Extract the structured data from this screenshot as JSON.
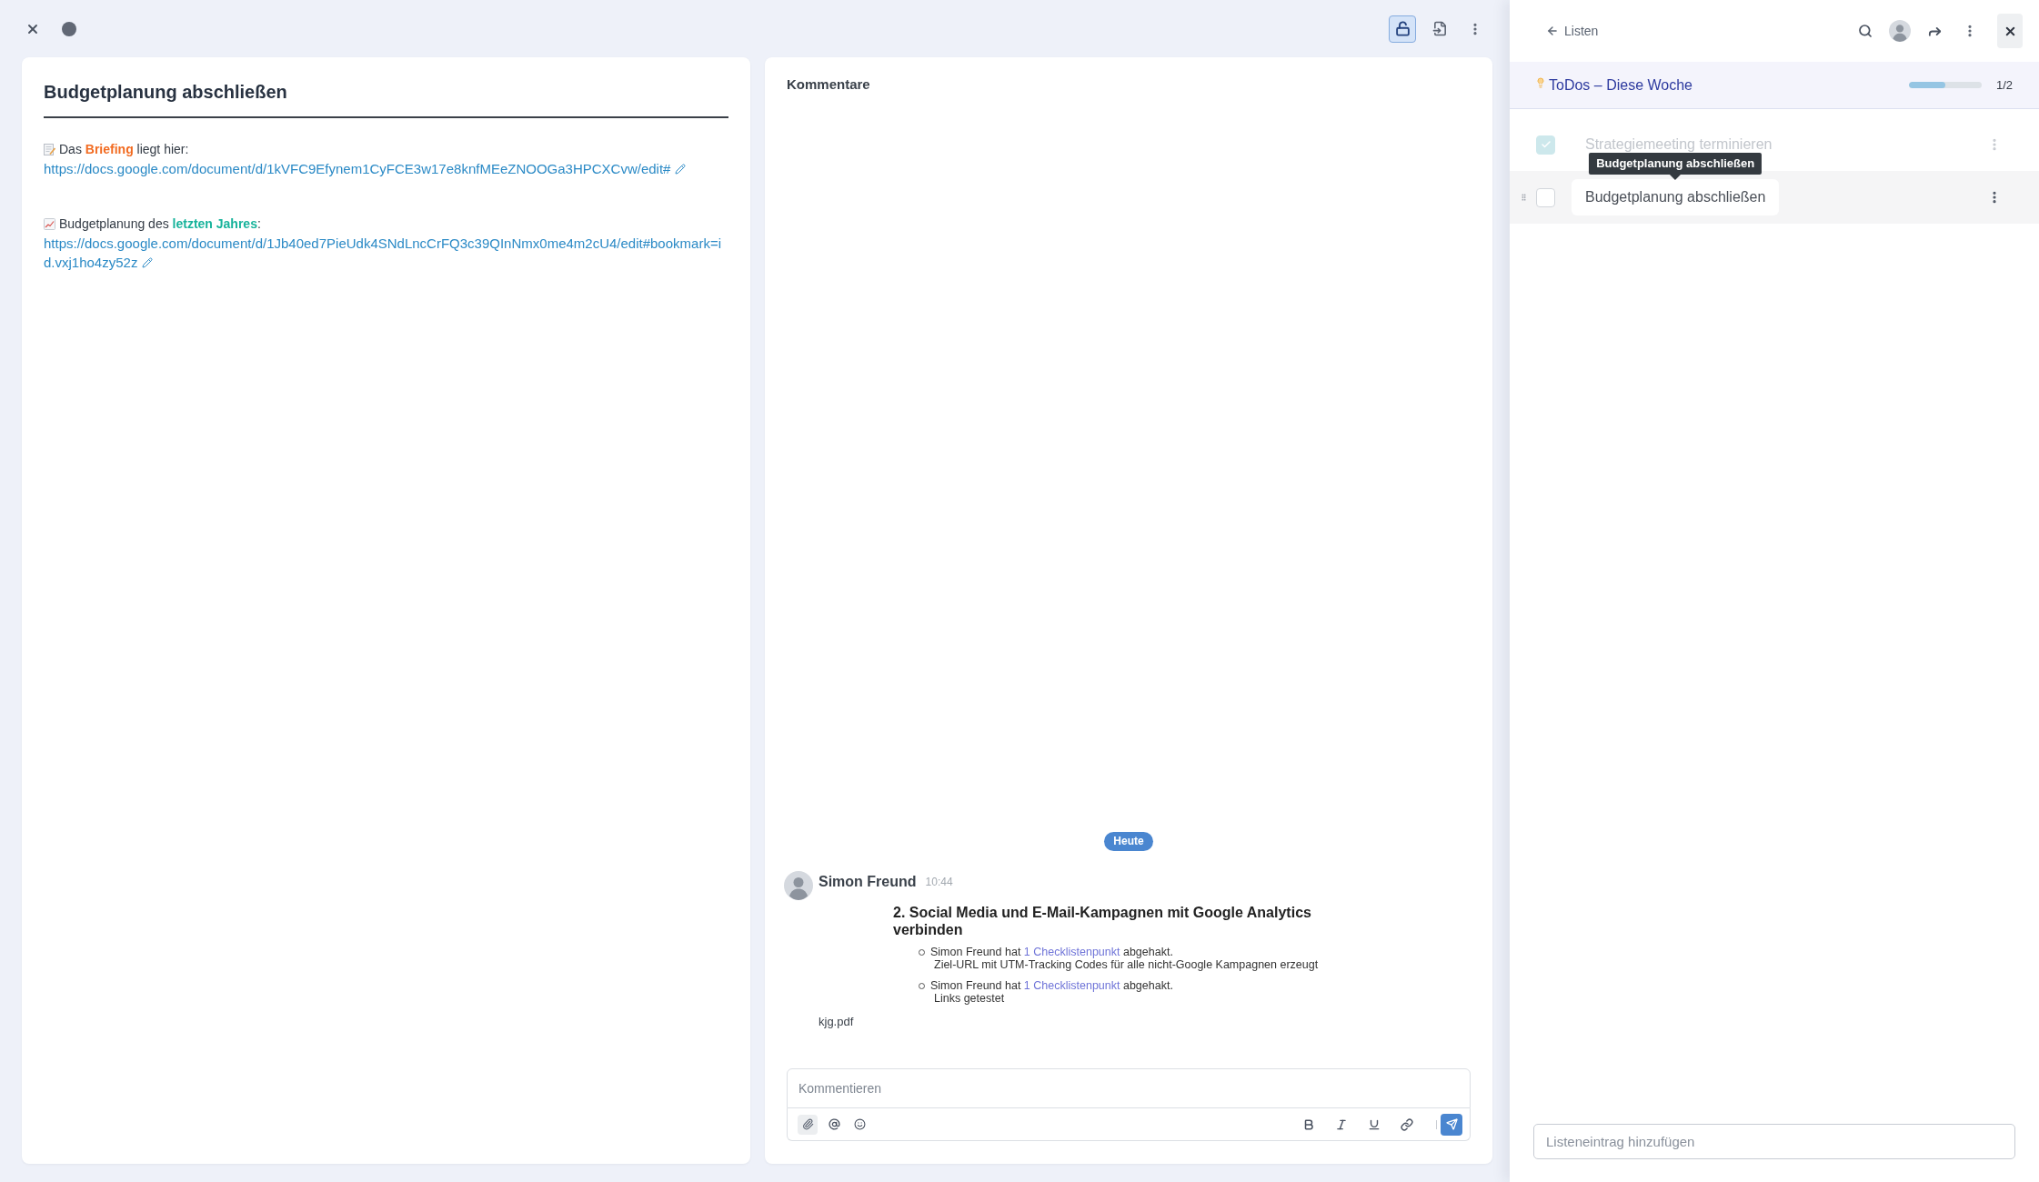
{
  "top_bar": {
    "lock_toggle": {
      "on": true
    }
  },
  "task": {
    "title": "Budgetplanung abschließen",
    "description": [
      {
        "kind": "memo",
        "text_before": "Das ",
        "highlight": "Briefing",
        "text_after": " liegt hier:",
        "color": "#f26b21",
        "link": "https://docs.google.com/document/d/1kVFC9Efynem1CyFCE3w17e8knfMEeZNOOGa3HPCXCvw/edit#"
      },
      {
        "kind": "chart",
        "text_before": "Budgetplanung des ",
        "highlight": "letzten Jahres",
        "text_after": ":",
        "color": "#17b39b",
        "link": "https://docs.google.com/document/d/1Jb40ed7PieUdk4SNdLncCrFQ3c39QInNmx0me4m2cU4/edit#bookmark=id.vxj1ho4zy52z"
      }
    ]
  },
  "comments": {
    "title": "Kommentare",
    "day_label": "Heute",
    "items": [
      {
        "author": "Simon Freund",
        "time": "10:44",
        "attachment": {
          "preview": {
            "heading": "2. Social Media und E-Mail-Kampagnen mit Google Analytics verbinden",
            "entries": [
              {
                "text_before": "Simon Freund hat",
                "link": "1 Checklistenpunkt",
                "text_after": "abgehakt.",
                "detail": "Ziel-URL mit UTM-Tracking Codes für alle nicht-Google Kampagnen erzeugt"
              },
              {
                "text_before": "Simon Freund hat",
                "link": "1 Checklistenpunkt",
                "text_after": "abgehakt.",
                "detail": "Links getestet"
              }
            ]
          },
          "file_name": "kjg.pdf"
        }
      }
    ],
    "input": {
      "placeholder": "Kommentieren"
    }
  },
  "list_panel": {
    "back_label": "Listen",
    "list": {
      "title": "ToDos – Diese Woche",
      "level": 0.5,
      "count": "1/2"
    },
    "items": [
      {
        "text": "Strategiemeeting terminieren",
        "checked": true,
        "selected": false
      },
      {
        "text": "Budgetplanung abschließen",
        "checked": false,
        "selected": true,
        "tooltip": "Budgetplanung abschließen"
      }
    ],
    "input": {
      "placeholder": "Listeneintrag hinzufügen"
    }
  }
}
